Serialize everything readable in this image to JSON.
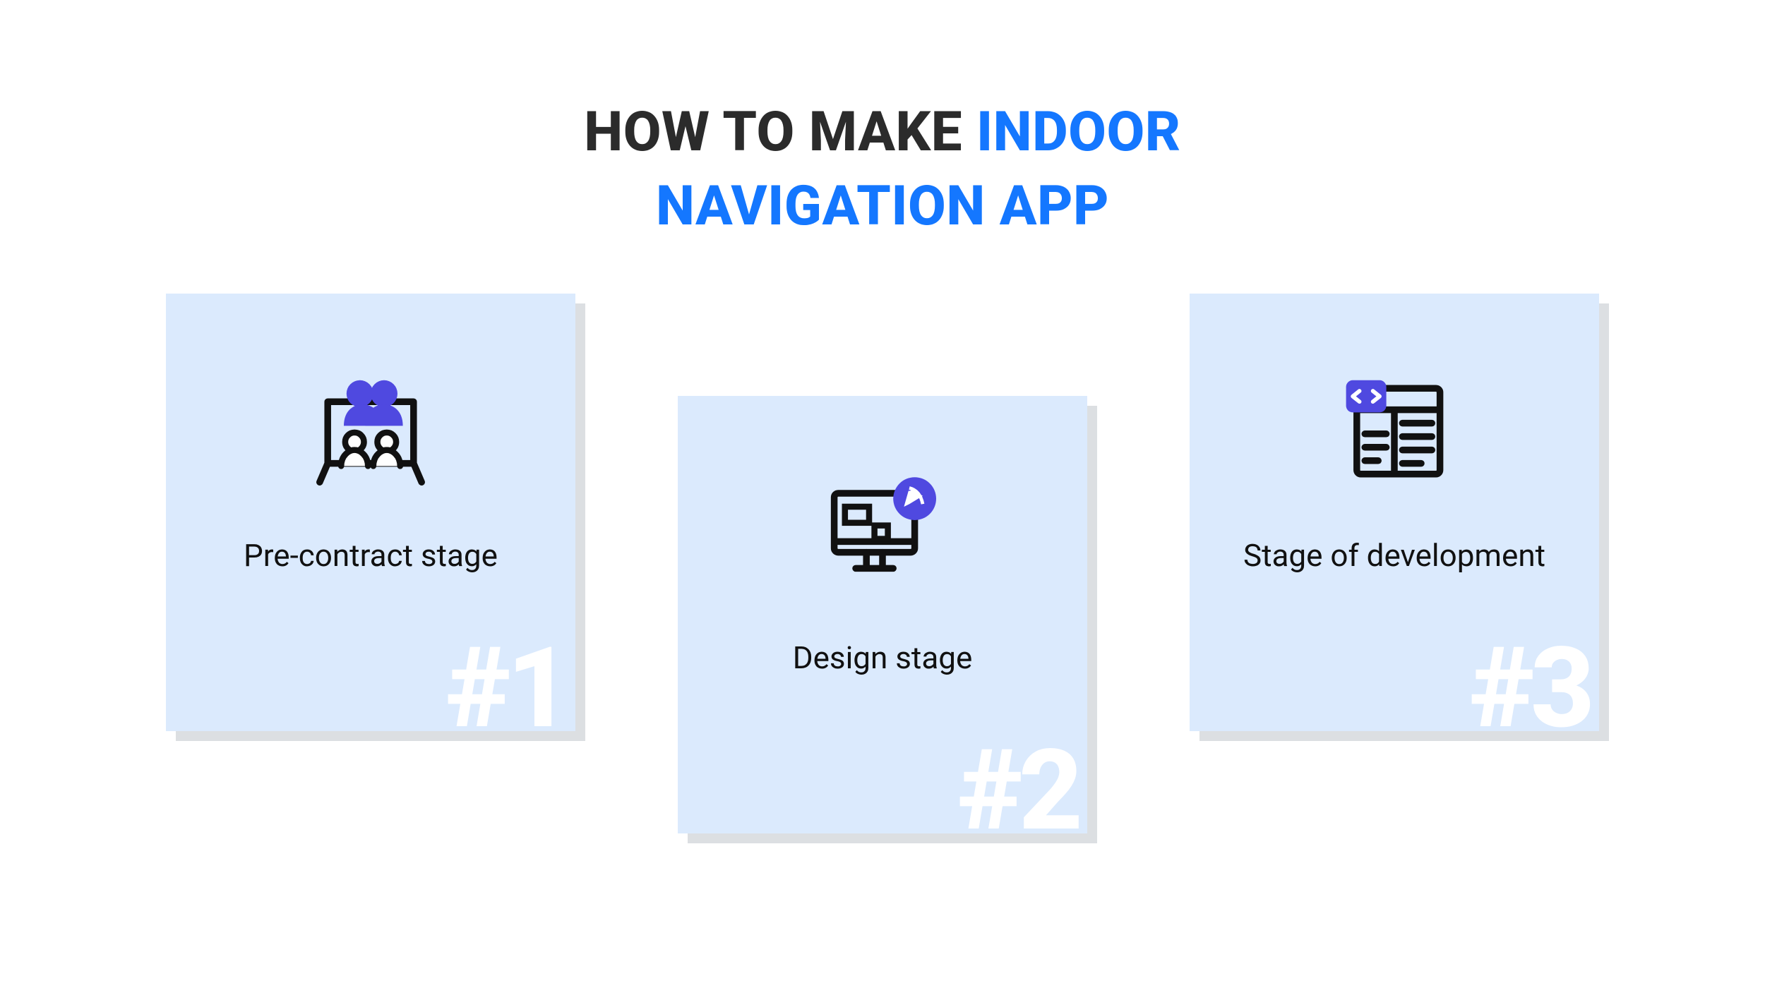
{
  "title": {
    "part1": "HOW TO MAKE",
    "part2": "INDOOR",
    "part3": "NAVIGATION APP"
  },
  "colors": {
    "accent": "#1477ff",
    "icon_fill": "#4f49e0",
    "card_bg": "#dbeafd",
    "shadow": "#dcdfe2"
  },
  "cards": [
    {
      "badge": "#1",
      "label": "Pre-contract stage",
      "icon": "team-board-icon"
    },
    {
      "badge": "#2",
      "label": "Design stage",
      "icon": "design-monitor-icon"
    },
    {
      "badge": "#3",
      "label": "Stage of development",
      "icon": "code-window-icon"
    }
  ]
}
